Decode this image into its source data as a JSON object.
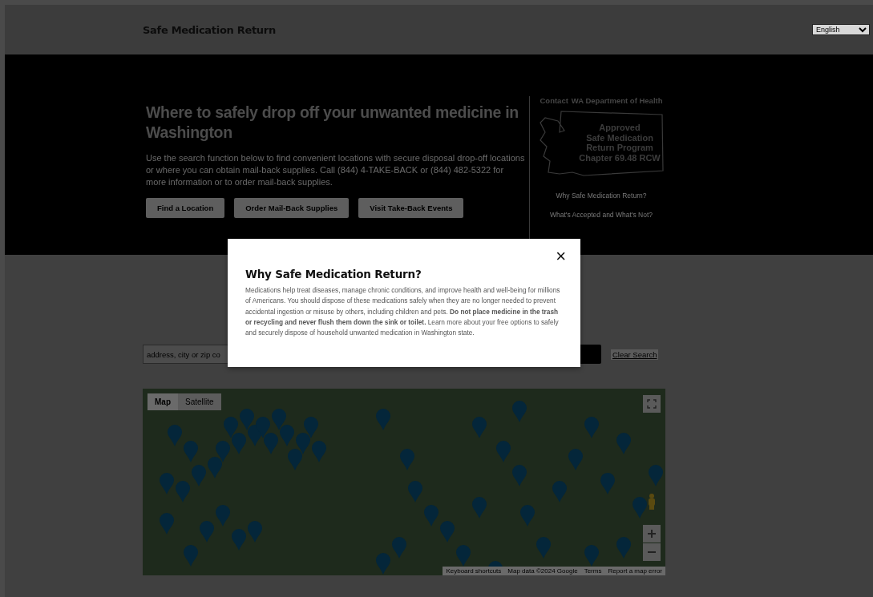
{
  "header": {
    "title": "Safe Medication Return",
    "language": "English"
  },
  "hero": {
    "heading": "Where to safely drop off your unwanted medicine in Washington",
    "intro": "Use the search function below to find convenient locations with secure disposal drop-off locations or where you can obtain mail-back supplies. Call (844) 4-TAKE-BACK or (844) 482-5322 for more information or to order mail-back supplies.",
    "buttons": [
      "Find a Location",
      "Order Mail-Back Supplies",
      "Visit Take-Back Events"
    ],
    "contact": {
      "label": "Contact",
      "link": "WA Department of Health"
    },
    "badge_lines": [
      "Approved",
      "Safe Medication",
      "Return Program",
      "Chapter 69.48 RCW"
    ],
    "links": [
      "Why Safe Medication Return?",
      "What's Accepted and What's Not?"
    ]
  },
  "search": {
    "placeholder": "address, city or zip co",
    "clear": "Clear Search"
  },
  "map": {
    "types": [
      {
        "label": "Map",
        "selected": true
      },
      {
        "label": "Satellite",
        "selected": false
      }
    ],
    "footer": [
      "Keyboard shortcuts",
      "Map data ©2024 Google",
      "Terms",
      "Report a map error"
    ]
  },
  "modal": {
    "title": "Why Safe Medication Return?",
    "body": "Medications help treat diseases, manage chronic conditions, and improve health and well-being for millions of Americans. You should dispose of these medications safely when they are no longer needed to prevent accidental ingestion or misuse by others, including children and pets. **Do not place medicine in the trash or recycling and never flush them down the sink or toilet.** Learn more about your free options to safely and securely dispose of household unwanted medication in Washington state.",
    "close": "×"
  }
}
